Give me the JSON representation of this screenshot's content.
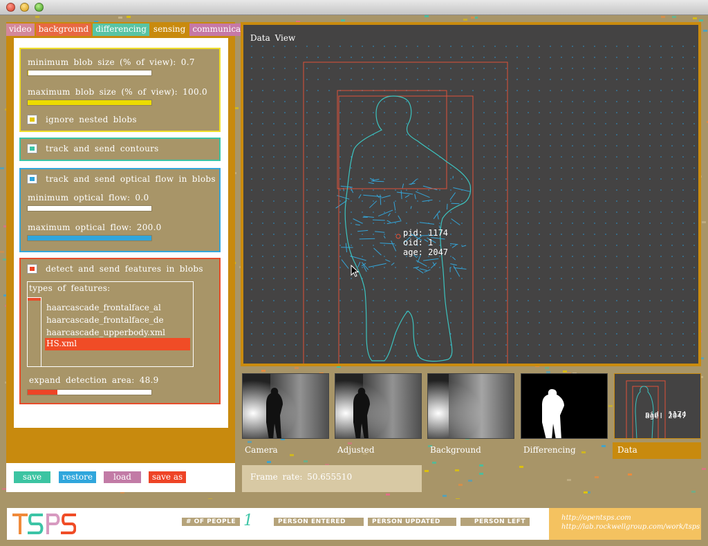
{
  "window": {
    "title": ""
  },
  "tabs": [
    {
      "label": "video",
      "active": false
    },
    {
      "label": "background",
      "active": false
    },
    {
      "label": "differencing",
      "active": false
    },
    {
      "label": "sensing",
      "active": true
    },
    {
      "label": "communication",
      "active": false
    }
  ],
  "blobs": {
    "min_label": "minimum blob size (% of view): 0.7",
    "min_value": 0.7,
    "max_label": "maximum blob size (% of view): 100.0",
    "max_value": 100.0,
    "ignore_nested_label": "ignore nested blobs",
    "ignore_nested_checked": true
  },
  "contours": {
    "label": "track and send contours",
    "checked": true
  },
  "optical_flow": {
    "label": "track and send optical flow in blobs",
    "checked": true,
    "min_label": "minimum optical flow: 0.0",
    "min_value": 0.0,
    "max_label": "maximum optical flow: 200.0",
    "max_value": 200.0
  },
  "features": {
    "label": "detect and send features in blobs",
    "checked": true,
    "types_label": "types of features:",
    "items": [
      {
        "label": "haarcascade_frontalface_al",
        "selected": false
      },
      {
        "label": "haarcascade_frontalface_de",
        "selected": false
      },
      {
        "label": "haarcascade_upperbody.xml",
        "selected": false
      },
      {
        "label": "HS.xml",
        "selected": true
      }
    ],
    "expand_label": "expand detection area: 48.9",
    "expand_value": 48.9
  },
  "buttons": {
    "save": "save",
    "restore": "restore",
    "load": "load",
    "save_as": "save as"
  },
  "data_view": {
    "title": "Data View",
    "person": {
      "pid": "pid: 1174",
      "oid": "oid: 1",
      "age": "age: 2047"
    }
  },
  "thumbnails": [
    {
      "label": "Camera"
    },
    {
      "label": "Adjusted"
    },
    {
      "label": "Background"
    },
    {
      "label": "Differencing"
    },
    {
      "label": "Data",
      "active": true
    }
  ],
  "frame_rate": "Frame rate: 50.655510",
  "footer": {
    "logo": "TSPS",
    "people_tag": "# OF PEOPLE",
    "people_count": "1",
    "entered": "PERSON ENTERED",
    "updated": "PERSON UPDATED",
    "left": "PERSON LEFT",
    "link1": "http://opentsps.com",
    "link2": "http://lab.rockwellgroup.com/work/tsps"
  },
  "colors": {
    "yellow": "#e2c600",
    "teal": "#3cc4a6",
    "blue": "#30a6dc",
    "red": "#ee4426",
    "panel_orange": "#c88a0e",
    "khaki": "#a89568",
    "dataview_bg": "#444343",
    "bbox_red": "#e0523a",
    "contour": "#3cc4c0"
  }
}
